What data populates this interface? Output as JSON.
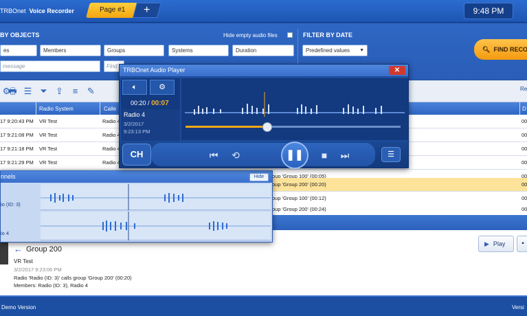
{
  "app": {
    "brand_prefix": "TRBOnet",
    "brand_name": "Voice Recorder",
    "page_tab": "Page #1",
    "add_tab_glyph": "+",
    "clock": "9:48 PM"
  },
  "filters": {
    "by_objects_title": "BY OBJECTS",
    "hide_empty": "Hide empty audio files",
    "by_date_title": "FILTER BY DATE",
    "tabs": [
      "es",
      "Members",
      "Groups",
      "Systems",
      "Duration"
    ],
    "date_select": "Predefined values",
    "message_placeholder": "message",
    "find_placeholder": "Find",
    "find_button": "FIND RECO"
  },
  "grid": {
    "right_header": "Re",
    "columns": [
      "",
      "Radio System",
      "Calle",
      "",
      "D"
    ],
    "rows": [
      {
        "time": "17 9:20:43 PM",
        "system": "VR Test",
        "caller": "Radio 4",
        "desc": "",
        "d": "00"
      },
      {
        "time": "17 9:21:08 PM",
        "system": "VR Test",
        "caller": "Radio 4",
        "desc": "",
        "d": "00"
      },
      {
        "time": "17 9:21:18 PM",
        "system": "VR Test",
        "caller": "Radio 4",
        "desc": "",
        "d": "00"
      },
      {
        "time": "17 9:21:29 PM",
        "system": "VR Test",
        "caller": "Radio 4",
        "desc": "",
        "d": "00"
      },
      {
        "time": "",
        "system": "",
        "caller": "",
        "desc": "oup 'Group 100' (00:05)",
        "d": "00"
      },
      {
        "time": "",
        "system": "",
        "caller": "",
        "desc": "oup 'Group 200' (00:20)",
        "d": "00"
      },
      {
        "time": "",
        "system": "",
        "caller": "",
        "desc": "oup 'Group 100' (00:12)",
        "d": "00"
      },
      {
        "time": "",
        "system": "",
        "caller": "",
        "desc": "oup 'Group 200' (00:24)",
        "d": "00"
      }
    ]
  },
  "detail": {
    "back_arrow": "←",
    "title": "Group 200",
    "system": "VR Test",
    "timestamp": "3/2/2017 9:23:06 PM",
    "summary": "Radio 'Radio (ID: 3)' calls group 'Group 200' (00:20)",
    "members": "Members: Radio (ID: 3), Radio 4",
    "play_label": "Play"
  },
  "status": {
    "left": "Demo Version",
    "right": "Versi"
  },
  "player": {
    "title": "TRBOnet Audio Player",
    "close_glyph": "✕",
    "elapsed": "00:20",
    "separator": "/",
    "position": "00:07",
    "source": "Radio 4",
    "date": "3/2/2017",
    "time": "9:23:13 PM",
    "ch_label": "CH",
    "progress_fraction": 0.38
  },
  "channels": {
    "title": "nnels",
    "hide": "Hide",
    "items": [
      "io (ID: 3)",
      "io 4"
    ]
  }
}
